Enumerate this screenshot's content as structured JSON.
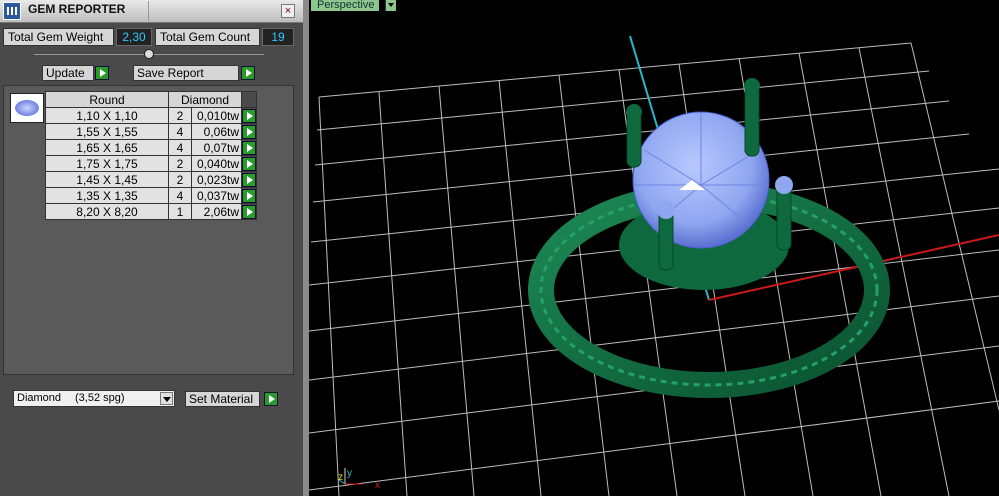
{
  "panel": {
    "title": "GEM REPORTER",
    "close_glyph": "×",
    "total_weight_label": "Total Gem Weight",
    "total_weight_value": "2,30",
    "total_count_label": "Total Gem Count",
    "total_count_value": "19",
    "update_label": "Update",
    "save_report_label": "Save Report",
    "grid": {
      "columns": [
        "Round",
        "Diamond"
      ],
      "rows": [
        {
          "size": "1,10 X 1,10",
          "count": "2",
          "weight": "0,010tw"
        },
        {
          "size": "1,55 X 1,55",
          "count": "4",
          "weight": "0,06tw"
        },
        {
          "size": "1,65 X 1,65",
          "count": "4",
          "weight": "0,07tw"
        },
        {
          "size": "1,75 X 1,75",
          "count": "2",
          "weight": "0,040tw"
        },
        {
          "size": "1,45 X 1,45",
          "count": "2",
          "weight": "0,023tw"
        },
        {
          "size": "1,35 X 1,35",
          "count": "4",
          "weight": "0,037tw"
        },
        {
          "size": "8,20 X 8,20",
          "count": "1",
          "weight": "2,06tw"
        }
      ]
    },
    "material": {
      "name": "Diamond",
      "spg": "(3,52 spg)"
    },
    "set_material_label": "Set Material"
  },
  "viewport": {
    "view_label": "Perspective",
    "axis_z": "z",
    "axis_y": "y",
    "axis_x": "x"
  },
  "colors": {
    "panel_bg": "#4a4a4a",
    "value_text": "#30c8ff",
    "go_button": "#2a9a2a",
    "metal": "#0e6a3e",
    "gem": "#8fa6f0",
    "viewport_bg": "#000000",
    "grid": "#cccccc",
    "axis_red": "#cc1a1a",
    "axis_cyan": "#2ab8c8"
  }
}
